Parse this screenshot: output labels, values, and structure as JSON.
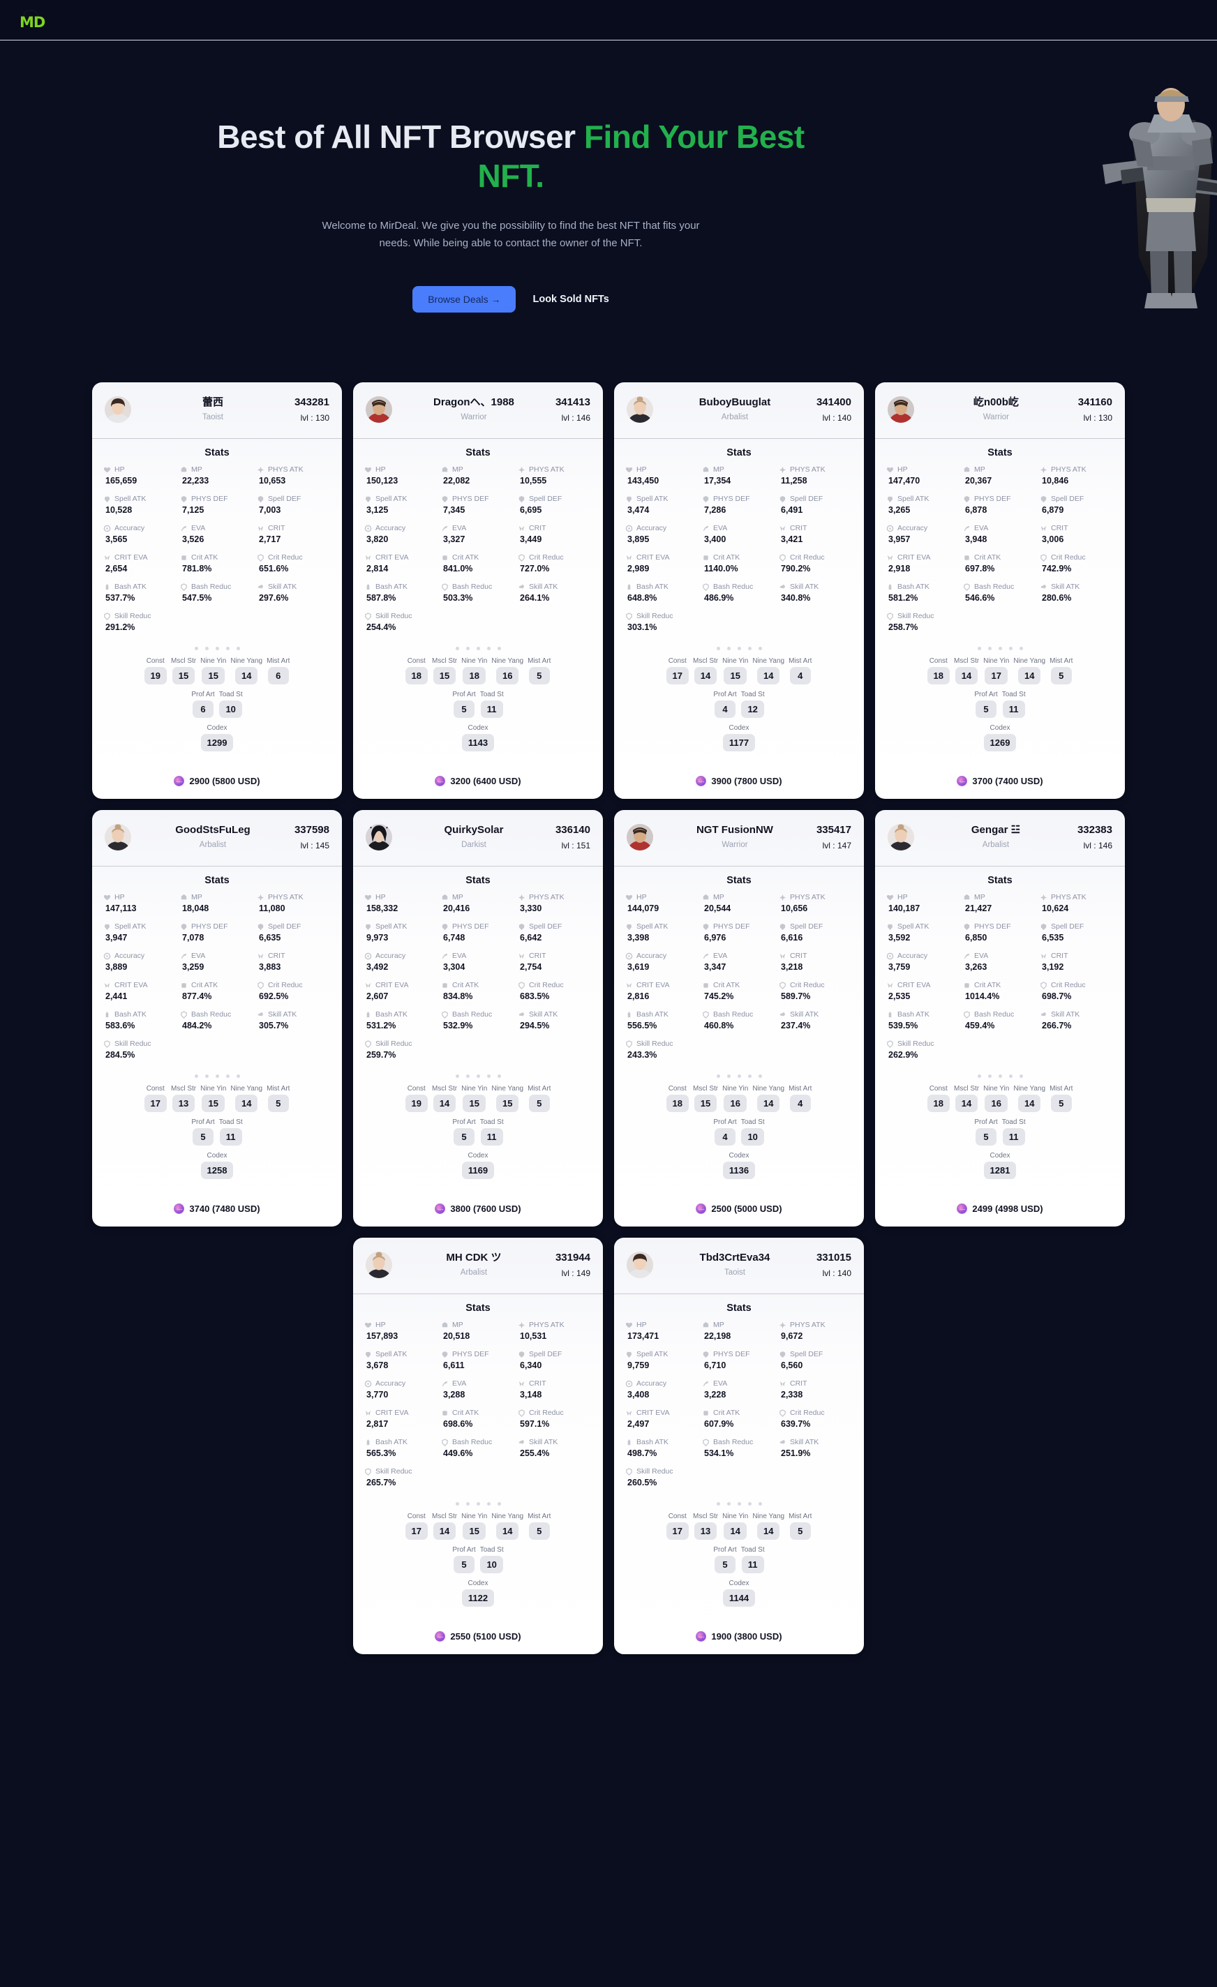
{
  "brand": {
    "logo_text": "MD",
    "logo_icon": "md-logo-icon"
  },
  "hero": {
    "title_part1": "Best of All NFT Browser ",
    "title_part2": "Find Your Best NFT.",
    "subtitle_line1": "Welcome to MirDeal. We give you the possibility to find the best NFT that fits your",
    "subtitle_line2": "needs. While being able to contact the owner of the NFT.",
    "primary_button": "Browse Deals →",
    "secondary_button": "Look Sold NFTs",
    "accent_color": "#22b14c",
    "primary_button_color": "#4a7dfc",
    "character_art": "warrior-character-art"
  },
  "labels": {
    "stats_title": "Stats",
    "lvl_prefix": "lvl : ",
    "stat_names": [
      "HP",
      "MP",
      "PHYS ATK",
      "Spell ATK",
      "PHYS DEF",
      "Spell DEF",
      "Accuracy",
      "EVA",
      "CRIT",
      "CRIT EVA",
      "Crit ATK",
      "Crit Reduc",
      "Bash ATK",
      "Bash Reduc",
      "Skill ATK",
      "Skill Reduc"
    ],
    "attr_row1": [
      "Const",
      "Mscl Str",
      "Nine Yin",
      "Nine Yang",
      "Mist Art"
    ],
    "attr_row2": [
      "Prof Art",
      "Toad St"
    ],
    "attr_row3": [
      "Codex"
    ]
  },
  "cards": [
    {
      "name": "蕾西",
      "class": "Taoist",
      "id": "343281",
      "lvl": "130",
      "avatar": "avatar-taoist-girl",
      "stats": [
        "165,659",
        "22,233",
        "10,653",
        "10,528",
        "7,125",
        "7,003",
        "3,565",
        "3,526",
        "2,717",
        "2,654",
        "781.8%",
        "651.6%",
        "537.7%",
        "547.5%",
        "297.6%",
        "291.2%"
      ],
      "attrs1": [
        "19",
        "15",
        "15",
        "14",
        "6"
      ],
      "attrs2": [
        "6",
        "10"
      ],
      "codex": "1299",
      "price": "2900 (5800 USD)"
    },
    {
      "name": "Dragonヘ、1988",
      "class": "Warrior",
      "id": "341413",
      "lvl": "146",
      "avatar": "avatar-warrior-man",
      "stats": [
        "150,123",
        "22,082",
        "10,555",
        "3,125",
        "7,345",
        "6,695",
        "3,820",
        "3,327",
        "3,449",
        "2,814",
        "841.0%",
        "727.0%",
        "587.8%",
        "503.3%",
        "264.1%",
        "254.4%"
      ],
      "attrs1": [
        "18",
        "15",
        "18",
        "16",
        "5"
      ],
      "attrs2": [
        "5",
        "11"
      ],
      "codex": "1143",
      "price": "3200 (6400 USD)"
    },
    {
      "name": "BuboyBuuglat",
      "class": "Arbalist",
      "id": "341400",
      "lvl": "140",
      "avatar": "avatar-arbalist-girl",
      "stats": [
        "143,450",
        "17,354",
        "11,258",
        "3,474",
        "7,286",
        "6,491",
        "3,895",
        "3,400",
        "3,421",
        "2,989",
        "1140.0%",
        "790.2%",
        "648.8%",
        "486.9%",
        "340.8%",
        "303.1%"
      ],
      "attrs1": [
        "17",
        "14",
        "15",
        "14",
        "4"
      ],
      "attrs2": [
        "4",
        "12"
      ],
      "codex": "1177",
      "price": "3900 (7800 USD)"
    },
    {
      "name": "屹n00b屹",
      "class": "Warrior",
      "id": "341160",
      "lvl": "130",
      "avatar": "avatar-warrior-man",
      "stats": [
        "147,470",
        "20,367",
        "10,846",
        "3,265",
        "6,878",
        "6,879",
        "3,957",
        "3,948",
        "3,006",
        "2,918",
        "697.8%",
        "742.9%",
        "581.2%",
        "546.6%",
        "280.6%",
        "258.7%"
      ],
      "attrs1": [
        "18",
        "14",
        "17",
        "14",
        "5"
      ],
      "attrs2": [
        "5",
        "11"
      ],
      "codex": "1269",
      "price": "3700 (7400 USD)"
    },
    {
      "name": "GoodStsFuLeg",
      "class": "Arbalist",
      "id": "337598",
      "lvl": "145",
      "avatar": "avatar-arbalist-girl",
      "stats": [
        "147,113",
        "18,048",
        "11,080",
        "3,947",
        "7,078",
        "6,635",
        "3,889",
        "3,259",
        "3,883",
        "2,441",
        "877.4%",
        "692.5%",
        "583.6%",
        "484.2%",
        "305.7%",
        "284.5%"
      ],
      "attrs1": [
        "17",
        "13",
        "15",
        "14",
        "5"
      ],
      "attrs2": [
        "5",
        "11"
      ],
      "codex": "1258",
      "price": "3740 (7480 USD)"
    },
    {
      "name": "QuirkySolar",
      "class": "Darkist",
      "id": "336140",
      "lvl": "151",
      "avatar": "avatar-darkist-girl",
      "stats": [
        "158,332",
        "20,416",
        "3,330",
        "9,973",
        "6,748",
        "6,642",
        "3,492",
        "3,304",
        "2,754",
        "2,607",
        "834.8%",
        "683.5%",
        "531.2%",
        "532.9%",
        "294.5%",
        "259.7%"
      ],
      "attrs1": [
        "19",
        "14",
        "15",
        "15",
        "5"
      ],
      "attrs2": [
        "5",
        "11"
      ],
      "codex": "1169",
      "price": "3800 (7600 USD)"
    },
    {
      "name": "NGT FusionNW",
      "class": "Warrior",
      "id": "335417",
      "lvl": "147",
      "avatar": "avatar-warrior-man",
      "stats": [
        "144,079",
        "20,544",
        "10,656",
        "3,398",
        "6,976",
        "6,616",
        "3,619",
        "3,347",
        "3,218",
        "2,816",
        "745.2%",
        "589.7%",
        "556.5%",
        "460.8%",
        "237.4%",
        "243.3%"
      ],
      "attrs1": [
        "18",
        "15",
        "16",
        "14",
        "4"
      ],
      "attrs2": [
        "4",
        "10"
      ],
      "codex": "1136",
      "price": "2500 (5000 USD)"
    },
    {
      "name": "Gengar ☳",
      "class": "Arbalist",
      "id": "332383",
      "lvl": "146",
      "avatar": "avatar-arbalist-girl",
      "stats": [
        "140,187",
        "21,427",
        "10,624",
        "3,592",
        "6,850",
        "6,535",
        "3,759",
        "3,263",
        "3,192",
        "2,535",
        "1014.4%",
        "698.7%",
        "539.5%",
        "459.4%",
        "266.7%",
        "262.9%"
      ],
      "attrs1": [
        "18",
        "14",
        "16",
        "14",
        "5"
      ],
      "attrs2": [
        "5",
        "11"
      ],
      "codex": "1281",
      "price": "2499 (4998 USD)"
    },
    {
      "name": "MH CDK ツ",
      "class": "Arbalist",
      "id": "331944",
      "lvl": "149",
      "avatar": "avatar-arbalist-girl",
      "stats": [
        "157,893",
        "20,518",
        "10,531",
        "3,678",
        "6,611",
        "6,340",
        "3,770",
        "3,288",
        "3,148",
        "2,817",
        "698.6%",
        "597.1%",
        "565.3%",
        "449.6%",
        "255.4%",
        "265.7%"
      ],
      "attrs1": [
        "17",
        "14",
        "15",
        "14",
        "5"
      ],
      "attrs2": [
        "5",
        "10"
      ],
      "codex": "1122",
      "price": "2550 (5100 USD)"
    },
    {
      "name": "Tbd3CrtEva34",
      "class": "Taoist",
      "id": "331015",
      "lvl": "140",
      "avatar": "avatar-taoist-girl",
      "stats": [
        "173,471",
        "22,198",
        "9,672",
        "9,759",
        "6,710",
        "6,560",
        "3,408",
        "3,228",
        "2,338",
        "2,497",
        "607.9%",
        "639.7%",
        "498.7%",
        "534.1%",
        "251.9%",
        "260.5%"
      ],
      "attrs1": [
        "17",
        "13",
        "14",
        "14",
        "5"
      ],
      "attrs2": [
        "5",
        "11"
      ],
      "codex": "1144",
      "price": "1900 (3800 USD)"
    }
  ]
}
